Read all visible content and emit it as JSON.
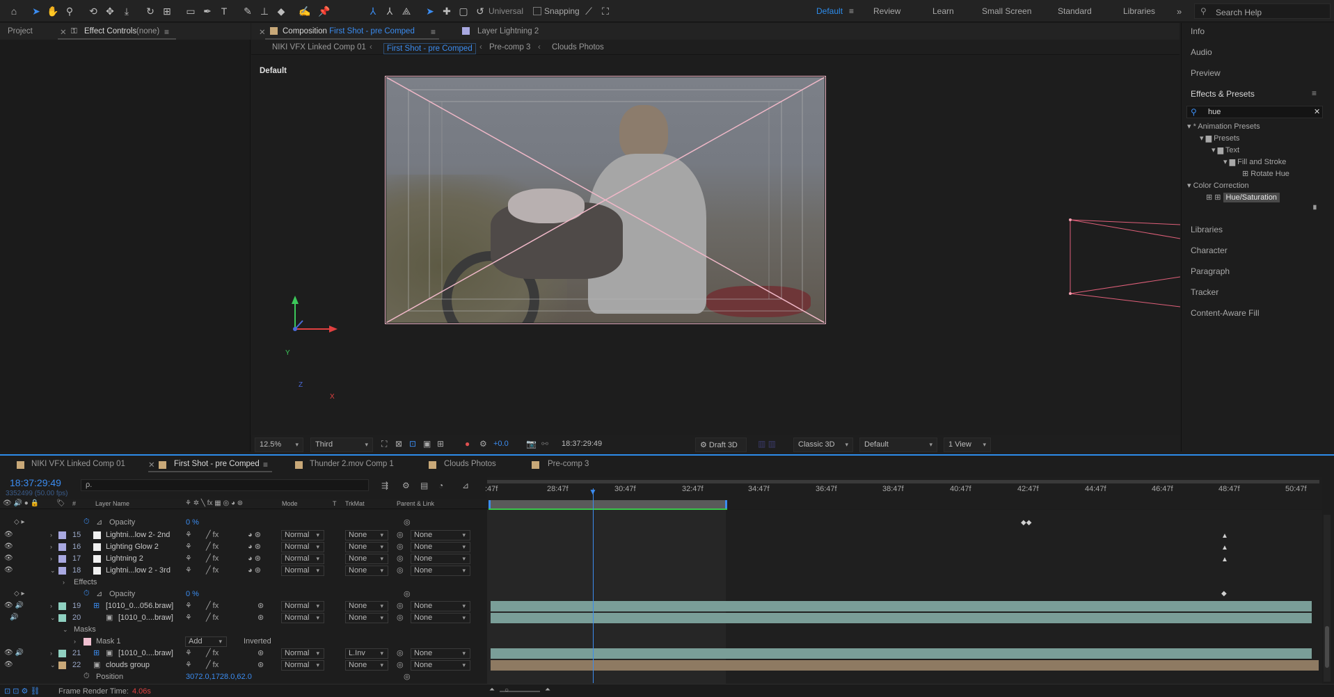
{
  "toolbar": {
    "tools": [
      "home-icon",
      "selection-icon",
      "hand-icon",
      "zoom-icon",
      "orbit-camera-icon",
      "pan-camera-icon",
      "dolly-camera-icon",
      "rotate-icon",
      "pan-behind-icon",
      "rectangle-icon",
      "pen-icon",
      "type-icon",
      "brush-icon",
      "clone-stamp-icon",
      "eraser-icon",
      "roto-brush-icon",
      "puppet-pin-icon"
    ],
    "universal_label": "Universal",
    "snapping_label": "Snapping",
    "workspaces": [
      "Default",
      "Review",
      "Learn",
      "Small Screen",
      "Standard",
      "Libraries"
    ],
    "active_workspace": "Default",
    "search_placeholder": "Search Help"
  },
  "project_panel": {
    "tab_project": "Project",
    "tab_effect_controls": "Effect Controls",
    "effect_controls_target": "(none)"
  },
  "composition_panel": {
    "tab_label": "Composition",
    "comp_name": "First Shot - pre Comped",
    "layer_tab": "Layer Lightning 2",
    "breadcrumbs": [
      "NIKI VFX Linked Comp 01",
      "First Shot - pre Comped",
      "Pre-comp 3",
      "Clouds Photos"
    ],
    "active_crumb": "First Shot - pre Comped",
    "renderer_label": "Default",
    "axis_x": "X",
    "axis_y": "Y",
    "axis_z": "Z"
  },
  "viewer_bar": {
    "zoom": "12.5%",
    "resolution": "Third",
    "exposure": "+0.0",
    "timecode": "18:37:29:49",
    "draft3d": "Draft 3D",
    "renderer": "Classic 3D",
    "camera": "Default",
    "views": "1 View"
  },
  "right_panel": {
    "items_top": [
      "Info",
      "Audio",
      "Preview"
    ],
    "effects_title": "Effects & Presets",
    "search_value": "hue",
    "tree": [
      {
        "label": "* Animation Presets",
        "indent": 0
      },
      {
        "label": "Presets",
        "indent": 1
      },
      {
        "label": "Text",
        "indent": 2
      },
      {
        "label": "Fill and Stroke",
        "indent": 3
      },
      {
        "label": "Rotate Hue",
        "indent": 4
      },
      {
        "label": "Color Correction",
        "indent": 0
      },
      {
        "label": "Hue/Saturation",
        "indent": 1
      }
    ],
    "items_bottom": [
      "Libraries",
      "Character",
      "Paragraph",
      "Tracker",
      "Content-Aware Fill"
    ]
  },
  "timeline": {
    "tabs": [
      "NIKI VFX Linked Comp 01",
      "First Shot - pre Comped",
      "Thunder 2.mov Comp 1",
      "Clouds Photos",
      "Pre-comp 3"
    ],
    "active_tab": "First Shot - pre Comped",
    "current_time": "18:37:29:49",
    "frame_info": "3352499 (50.00 fps)",
    "search_placeholder": "ρ.",
    "columns": {
      "layer_name": "Layer Name",
      "mode": "Mode",
      "t": "T",
      "trkmat": "TrkMat",
      "parent": "Parent & Link",
      "hash": "#"
    },
    "ruler": [
      ":47f",
      "28:47f",
      "30:47f",
      "32:47f",
      "34:47f",
      "36:47f",
      "38:47f",
      "40:47f",
      "42:47f",
      "44:47f",
      "46:47f",
      "48:47f",
      "50:47f"
    ],
    "rows": [
      {
        "type": "prop",
        "label": "Opacity",
        "value": "0 %"
      },
      {
        "type": "layer",
        "num": "15",
        "name": "Lightni...low 2- 2nd",
        "mode": "Normal",
        "trkmat": "None",
        "parent": "None",
        "color": "#a8a8e0"
      },
      {
        "type": "layer",
        "num": "16",
        "name": "Lighting Glow 2",
        "mode": "Normal",
        "trkmat": "None",
        "parent": "None",
        "color": "#a8a8e0"
      },
      {
        "type": "layer",
        "num": "17",
        "name": "Lightning 2",
        "mode": "Normal",
        "trkmat": "None",
        "parent": "None",
        "color": "#a8a8e0"
      },
      {
        "type": "layer",
        "num": "18",
        "name": "Lightni...low 2 - 3rd",
        "mode": "Normal",
        "trkmat": "None",
        "parent": "None",
        "color": "#a8a8e0"
      },
      {
        "type": "group",
        "label": "Effects"
      },
      {
        "type": "prop",
        "label": "Opacity",
        "value": "0 %"
      },
      {
        "type": "layer",
        "num": "19",
        "name": "[1010_0...056.braw]",
        "mode": "Normal",
        "trkmat": "None",
        "parent": "None",
        "color": "#8fd0c0"
      },
      {
        "type": "layer",
        "num": "20",
        "name": "[1010_0....braw]",
        "mode": "Normal",
        "trkmat": "None",
        "parent": "None",
        "color": "#8fd0c0"
      },
      {
        "type": "group",
        "label": "Masks"
      },
      {
        "type": "mask",
        "label": "Mask 1",
        "mode": "Add",
        "inverted": "Inverted"
      },
      {
        "type": "layer",
        "num": "21",
        "name": "[1010_0....braw]",
        "mode": "Normal",
        "trkmat": "L.Inv",
        "parent": "None",
        "color": "#8fd0c0"
      },
      {
        "type": "layer",
        "num": "22",
        "name": "clouds group",
        "mode": "Normal",
        "trkmat": "None",
        "parent": "None",
        "color": "#c8a878"
      },
      {
        "type": "prop",
        "label": "Position",
        "value": "3072.0,1728.0,62.0"
      }
    ],
    "footer_label": "Frame Render Time:",
    "footer_value": "4.06s"
  }
}
